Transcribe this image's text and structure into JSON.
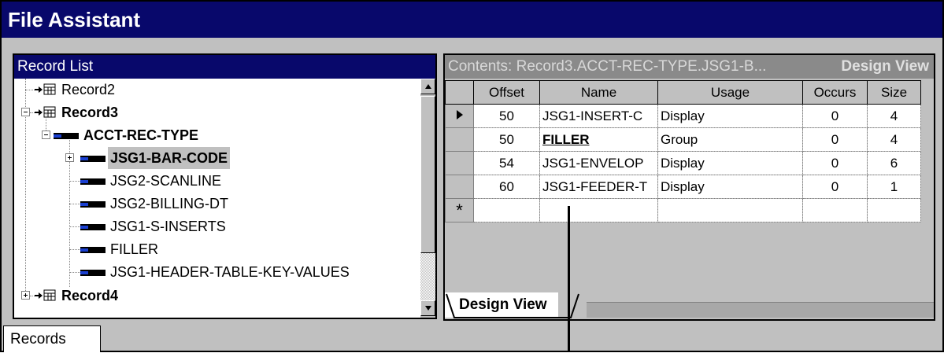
{
  "window": {
    "title": "File Assistant"
  },
  "record_list": {
    "title": "Record List",
    "items": [
      {
        "label": "Record2",
        "type": "record",
        "bold": false
      },
      {
        "label": "Record3",
        "type": "record",
        "bold": true
      },
      {
        "label": "ACCT-REC-TYPE",
        "type": "field",
        "bold": true
      },
      {
        "label": "JSG1-BAR-CODE",
        "type": "field",
        "bold": true,
        "selected": true
      },
      {
        "label": "JSG2-SCANLINE",
        "type": "field",
        "bold": false
      },
      {
        "label": "JSG2-BILLING-DT",
        "type": "field",
        "bold": false
      },
      {
        "label": "JSG1-S-INSERTS",
        "type": "field",
        "bold": false
      },
      {
        "label": "FILLER",
        "type": "field",
        "bold": false
      },
      {
        "label": "JSG1-HEADER-TABLE-KEY-VALUES",
        "type": "field",
        "bold": false
      },
      {
        "label": "Record4",
        "type": "record",
        "bold": true
      }
    ]
  },
  "contents": {
    "title": "Contents: Record3.ACCT-REC-TYPE.JSG1-B...",
    "view_label": "Design View",
    "columns": [
      "Offset",
      "Name",
      "Usage",
      "Occurs",
      "Size"
    ],
    "rows": [
      {
        "offset": "50",
        "name": "JSG1-INSERT-C",
        "usage": "Display",
        "occurs": "0",
        "size": "4"
      },
      {
        "offset": "50",
        "name": "FILLER",
        "usage": "Group",
        "occurs": "0",
        "size": "4"
      },
      {
        "offset": "54",
        "name": "JSG1-ENVELOP",
        "usage": "Display",
        "occurs": "0",
        "size": "6"
      },
      {
        "offset": "60",
        "name": "JSG1-FEEDER-T",
        "usage": "Display",
        "occurs": "0",
        "size": "1"
      }
    ],
    "new_row_marker": "*",
    "tab_label": "Design View"
  },
  "bottom_tabs": {
    "records": "Records"
  },
  "colors": {
    "titlebar": "#08086b",
    "panel_bg": "#c0c0c0",
    "header_gray": "#8a8a8a"
  },
  "icons": {
    "record": "table-icon",
    "field": "field-bar-icon",
    "selector": "triangle-right-icon"
  }
}
